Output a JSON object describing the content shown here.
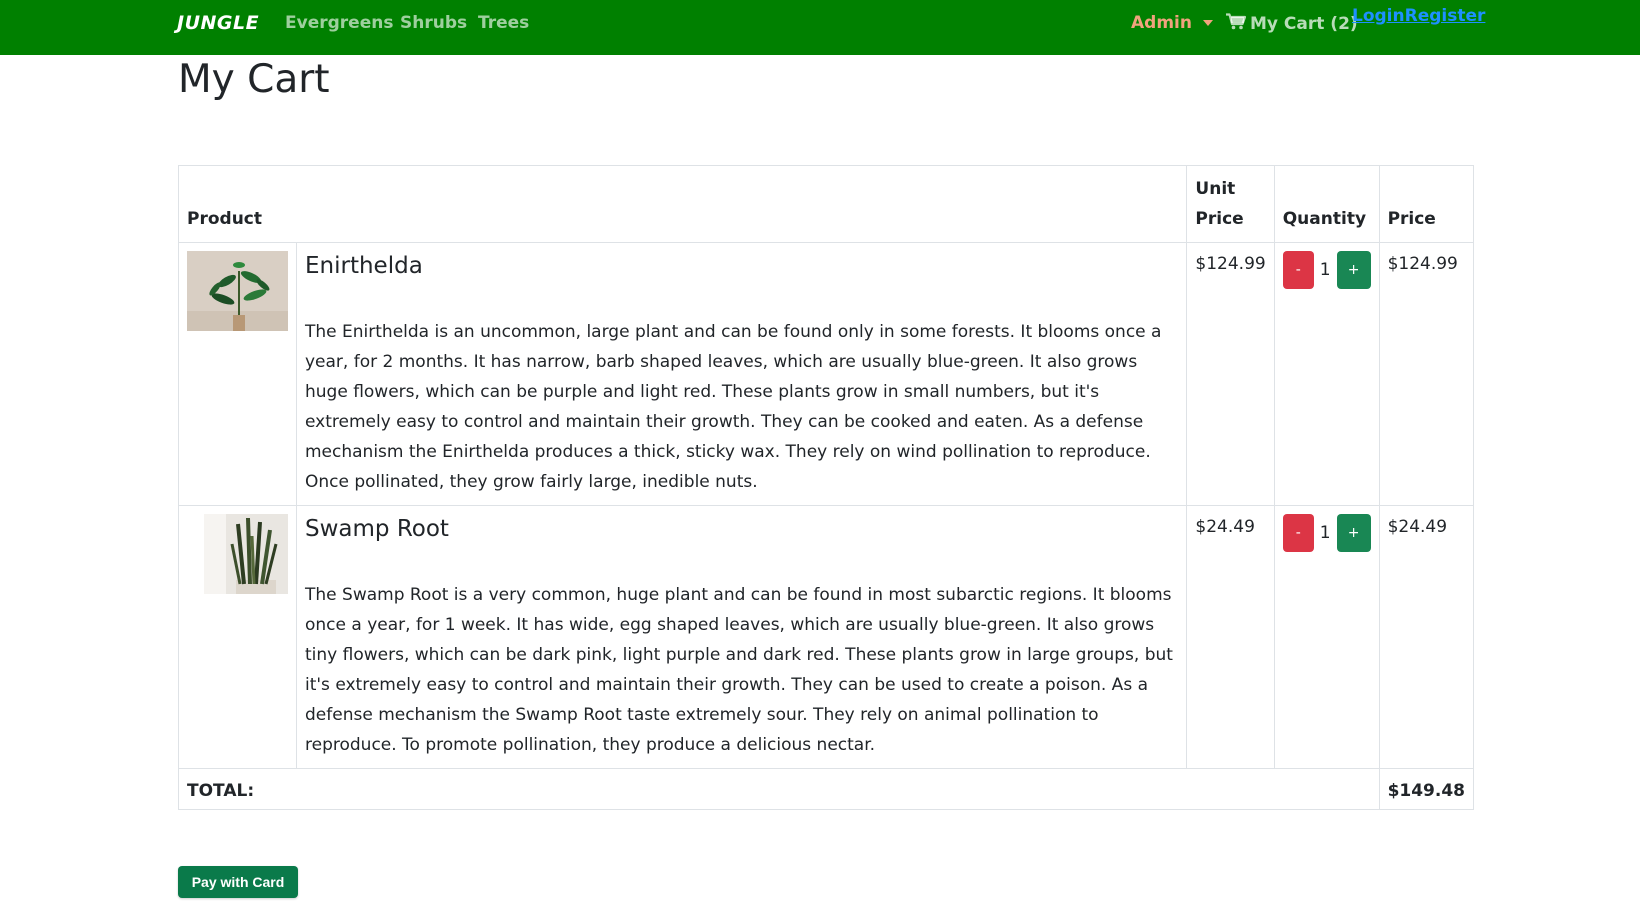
{
  "navbar": {
    "brand": "JUNGLE",
    "links": [
      "Evergreens",
      "Shrubs",
      "Trees"
    ],
    "admin_label": "Admin",
    "cart_label": "My Cart (2)",
    "login_label": "Login",
    "register_label": "Register",
    "colors": {
      "background": "#008000",
      "admin": "#f0a37d",
      "auth_link": "#1e90ff"
    }
  },
  "page": {
    "title": "My Cart"
  },
  "table": {
    "headers": {
      "product": "Product",
      "unit_price": "Unit Price",
      "quantity": "Quantity",
      "price": "Price"
    },
    "rows": [
      {
        "name": "Enirthelda",
        "image_icon": "plant-photo",
        "description": "The Enirthelda is an uncommon, large plant and can be found only in some forests. It blooms once a year, for 2 months. It has narrow, barb shaped leaves, which are usually blue-green. It also grows huge flowers, which can be purple and light red. These plants grow in small numbers, but it's extremely easy to control and maintain their growth. They can be cooked and eaten. As a defense mechanism the Enirthelda produces a thick, sticky wax. They rely on wind pollination to reproduce. Once pollinated, they grow fairly large, inedible nuts.",
        "unit_price": "$124.99",
        "quantity": "1",
        "price": "$124.99"
      },
      {
        "name": "Swamp Root",
        "image_icon": "snake-plant-photo",
        "description": "The Swamp Root is a very common, huge plant and can be found in most subarctic regions. It blooms once a year, for 1 week. It has wide, egg shaped leaves, which are usually blue-green. It also grows tiny flowers, which can be dark pink, light purple and dark red. These plants grow in large groups, but it's extremely easy to control and maintain their growth. They can be used to create a poison. As a defense mechanism the Swamp Root taste extremely sour. They rely on animal pollination to reproduce. To promote pollination, they produce a delicious nectar.",
        "unit_price": "$24.49",
        "quantity": "1",
        "price": "$24.49"
      }
    ],
    "minus_label": "-",
    "plus_label": "+",
    "total_label": "TOTAL:",
    "total_value": "$149.48"
  },
  "pay_button": "Pay with Card"
}
